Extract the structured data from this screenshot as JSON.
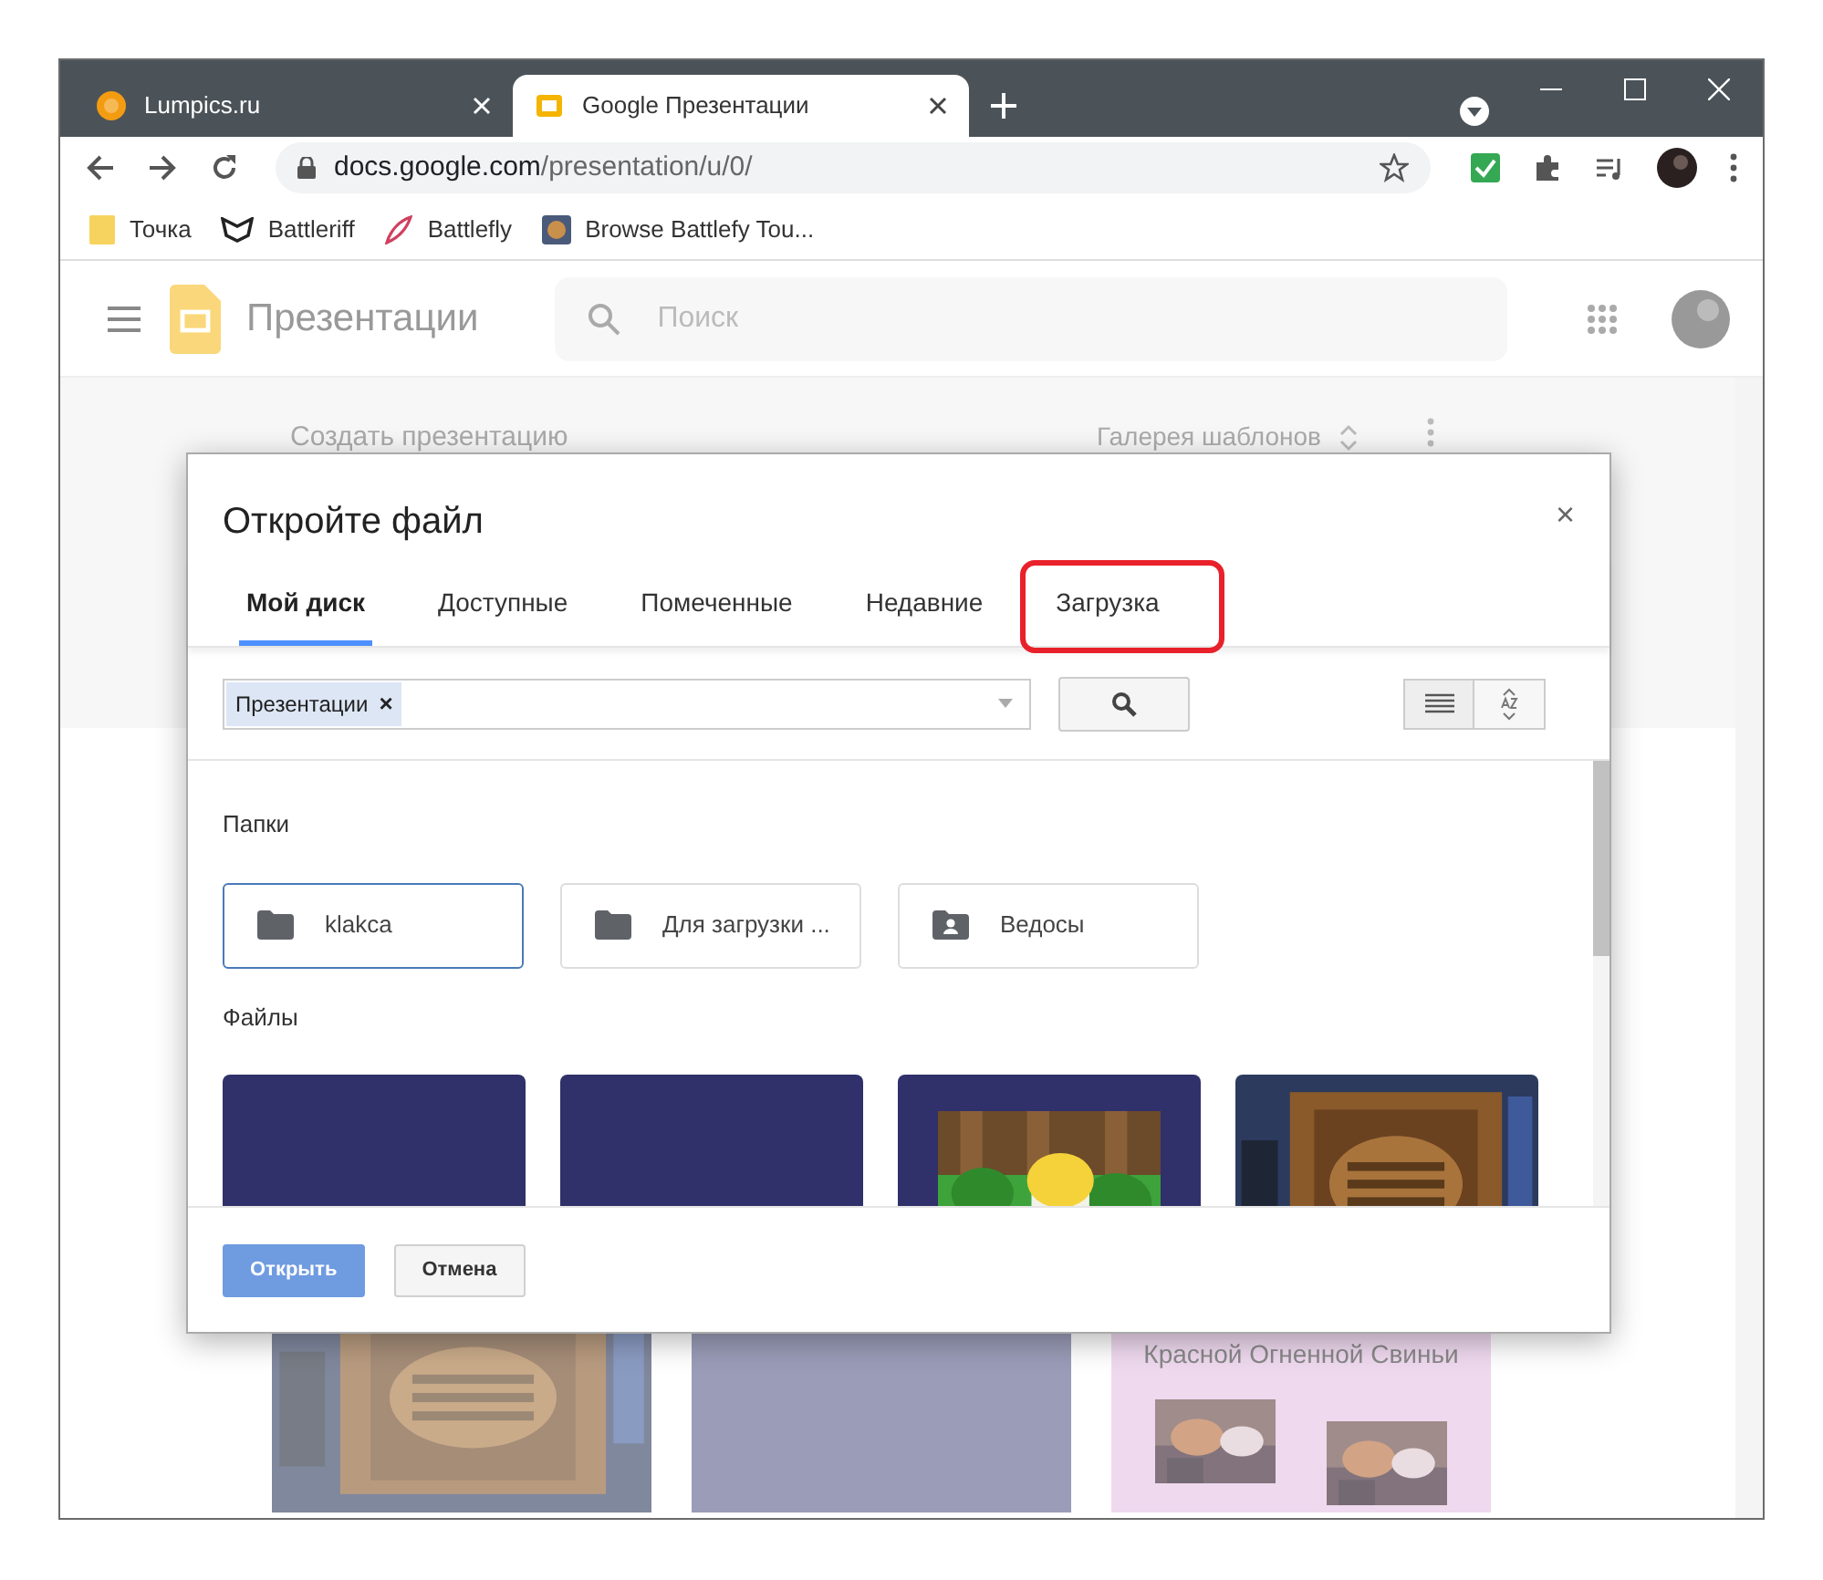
{
  "browser": {
    "tabs": [
      {
        "title": "Lumpics.ru",
        "selected": false
      },
      {
        "title": "Google Презентации",
        "selected": true
      }
    ],
    "url": {
      "domain": "docs.google.com",
      "path": "/presentation/u/0/"
    },
    "bookmarks": [
      "Точка",
      "Battleriff",
      "Battlefly",
      "Browse Battlefy Tou..."
    ]
  },
  "app": {
    "title": "Презентации",
    "search_placeholder": "Поиск",
    "create_label": "Создать презентацию",
    "gallery_label": "Галерея шаблонов",
    "slides": [
      {
        "kind": "picture"
      },
      {
        "kind": "blank"
      },
      {
        "kind": "text",
        "lines": [
          "Красной Огненной Свиньи"
        ]
      }
    ]
  },
  "dialog": {
    "title": "Откройте файл",
    "close": "×",
    "tabs": [
      {
        "label": "Мой диск",
        "selected": true,
        "highlighted": false
      },
      {
        "label": "Доступные",
        "selected": false,
        "highlighted": false
      },
      {
        "label": "Помеченные",
        "selected": false,
        "highlighted": false
      },
      {
        "label": "Недавние",
        "selected": false,
        "highlighted": false
      },
      {
        "label": "Загрузка",
        "selected": false,
        "highlighted": true
      }
    ],
    "filter_chip": "Презентации",
    "chip_remove": "×",
    "folders_heading": "Папки",
    "folders": [
      {
        "name": "klakca",
        "kind": "folder",
        "selected": true
      },
      {
        "name": "Для загрузки ...",
        "kind": "folder",
        "selected": false
      },
      {
        "name": "Ведосы",
        "kind": "shared",
        "selected": false
      }
    ],
    "files_heading": "Файлы",
    "files": [
      {
        "kind": "blank"
      },
      {
        "kind": "blank"
      },
      {
        "kind": "inset"
      },
      {
        "kind": "picture"
      }
    ],
    "buttons": [
      {
        "label": "Открыть",
        "disabled": true
      },
      {
        "label": "Отмена",
        "disabled": false
      }
    ]
  }
}
